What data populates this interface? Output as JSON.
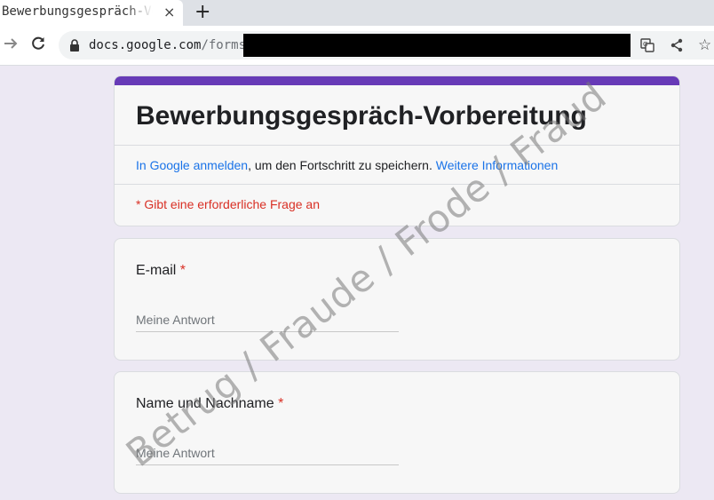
{
  "browser": {
    "tab_title": "Bewerbungsgespräch-Vorbereitung",
    "tab_close": "×",
    "new_tab": "+",
    "url_host": "docs.google.com",
    "url_path": "/forms/",
    "star": "☆"
  },
  "form": {
    "title": "Bewerbungsgespräch-Vorbereitung",
    "signin_link": "In Google anmelden",
    "signin_text": ", um den Fortschritt zu speichern.",
    "more_info_link": "Weitere Informationen",
    "required_note": "* Gibt eine erforderliche Frage an",
    "accent_color": "#673ab7",
    "questions": [
      {
        "label": "E-mail",
        "required_mark": "*",
        "placeholder": "Meine Antwort"
      },
      {
        "label": "Name und Nachname",
        "required_mark": "*",
        "placeholder": "Meine Antwort"
      }
    ]
  },
  "watermark": "Betrug / Fraude / Frode / Fraud"
}
